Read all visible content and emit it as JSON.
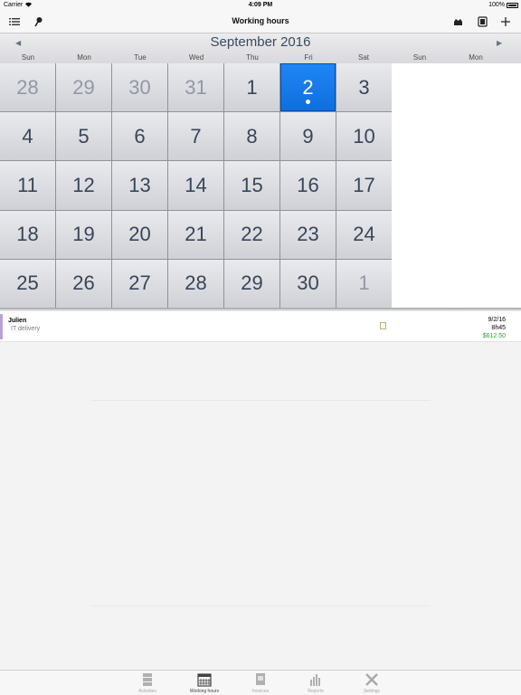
{
  "status_bar": {
    "carrier": "Carrier",
    "time": "4:09 PM",
    "battery": "100%"
  },
  "nav": {
    "title": "Working hours"
  },
  "calendar": {
    "month_title": "September 2016",
    "prev_arrow": "◀",
    "next_arrow": "▶",
    "weekdays": [
      "Sun",
      "Mon",
      "Tue",
      "Wed",
      "Thu",
      "Fri",
      "Sat",
      "Sun",
      "Mon"
    ],
    "days": [
      {
        "label": "28",
        "other": true
      },
      {
        "label": "29",
        "other": true
      },
      {
        "label": "30",
        "other": true
      },
      {
        "label": "31",
        "other": true
      },
      {
        "label": "1"
      },
      {
        "label": "2",
        "selected": true,
        "has_entry": true
      },
      {
        "label": "3"
      },
      {
        "label": "4"
      },
      {
        "label": "5"
      },
      {
        "label": "6"
      },
      {
        "label": "7"
      },
      {
        "label": "8"
      },
      {
        "label": "9"
      },
      {
        "label": "10"
      },
      {
        "label": "11"
      },
      {
        "label": "12"
      },
      {
        "label": "13"
      },
      {
        "label": "14"
      },
      {
        "label": "15"
      },
      {
        "label": "16"
      },
      {
        "label": "17"
      },
      {
        "label": "18"
      },
      {
        "label": "19"
      },
      {
        "label": "20"
      },
      {
        "label": "21"
      },
      {
        "label": "22"
      },
      {
        "label": "23"
      },
      {
        "label": "24"
      },
      {
        "label": "25"
      },
      {
        "label": "26"
      },
      {
        "label": "27"
      },
      {
        "label": "28"
      },
      {
        "label": "29"
      },
      {
        "label": "30"
      },
      {
        "label": "1",
        "other": true
      }
    ]
  },
  "entry": {
    "name": "Julien",
    "project": "IT delivery",
    "date": "9/2/16",
    "duration": "8h45",
    "amount": "$612.50",
    "accent_color": "#b9a3d4",
    "amount_color": "#2aa32a"
  },
  "colors": {
    "selected_day": "#1e86f5",
    "day_text": "#3a4557"
  },
  "tabs": [
    {
      "label": "Activities",
      "icon": "stack-icon"
    },
    {
      "label": "Working hours",
      "icon": "calendar-icon",
      "active": true
    },
    {
      "label": "Invoices",
      "icon": "invoice-icon"
    },
    {
      "label": "Reports",
      "icon": "bar-chart-icon"
    },
    {
      "label": "Settings",
      "icon": "tools-icon"
    }
  ]
}
